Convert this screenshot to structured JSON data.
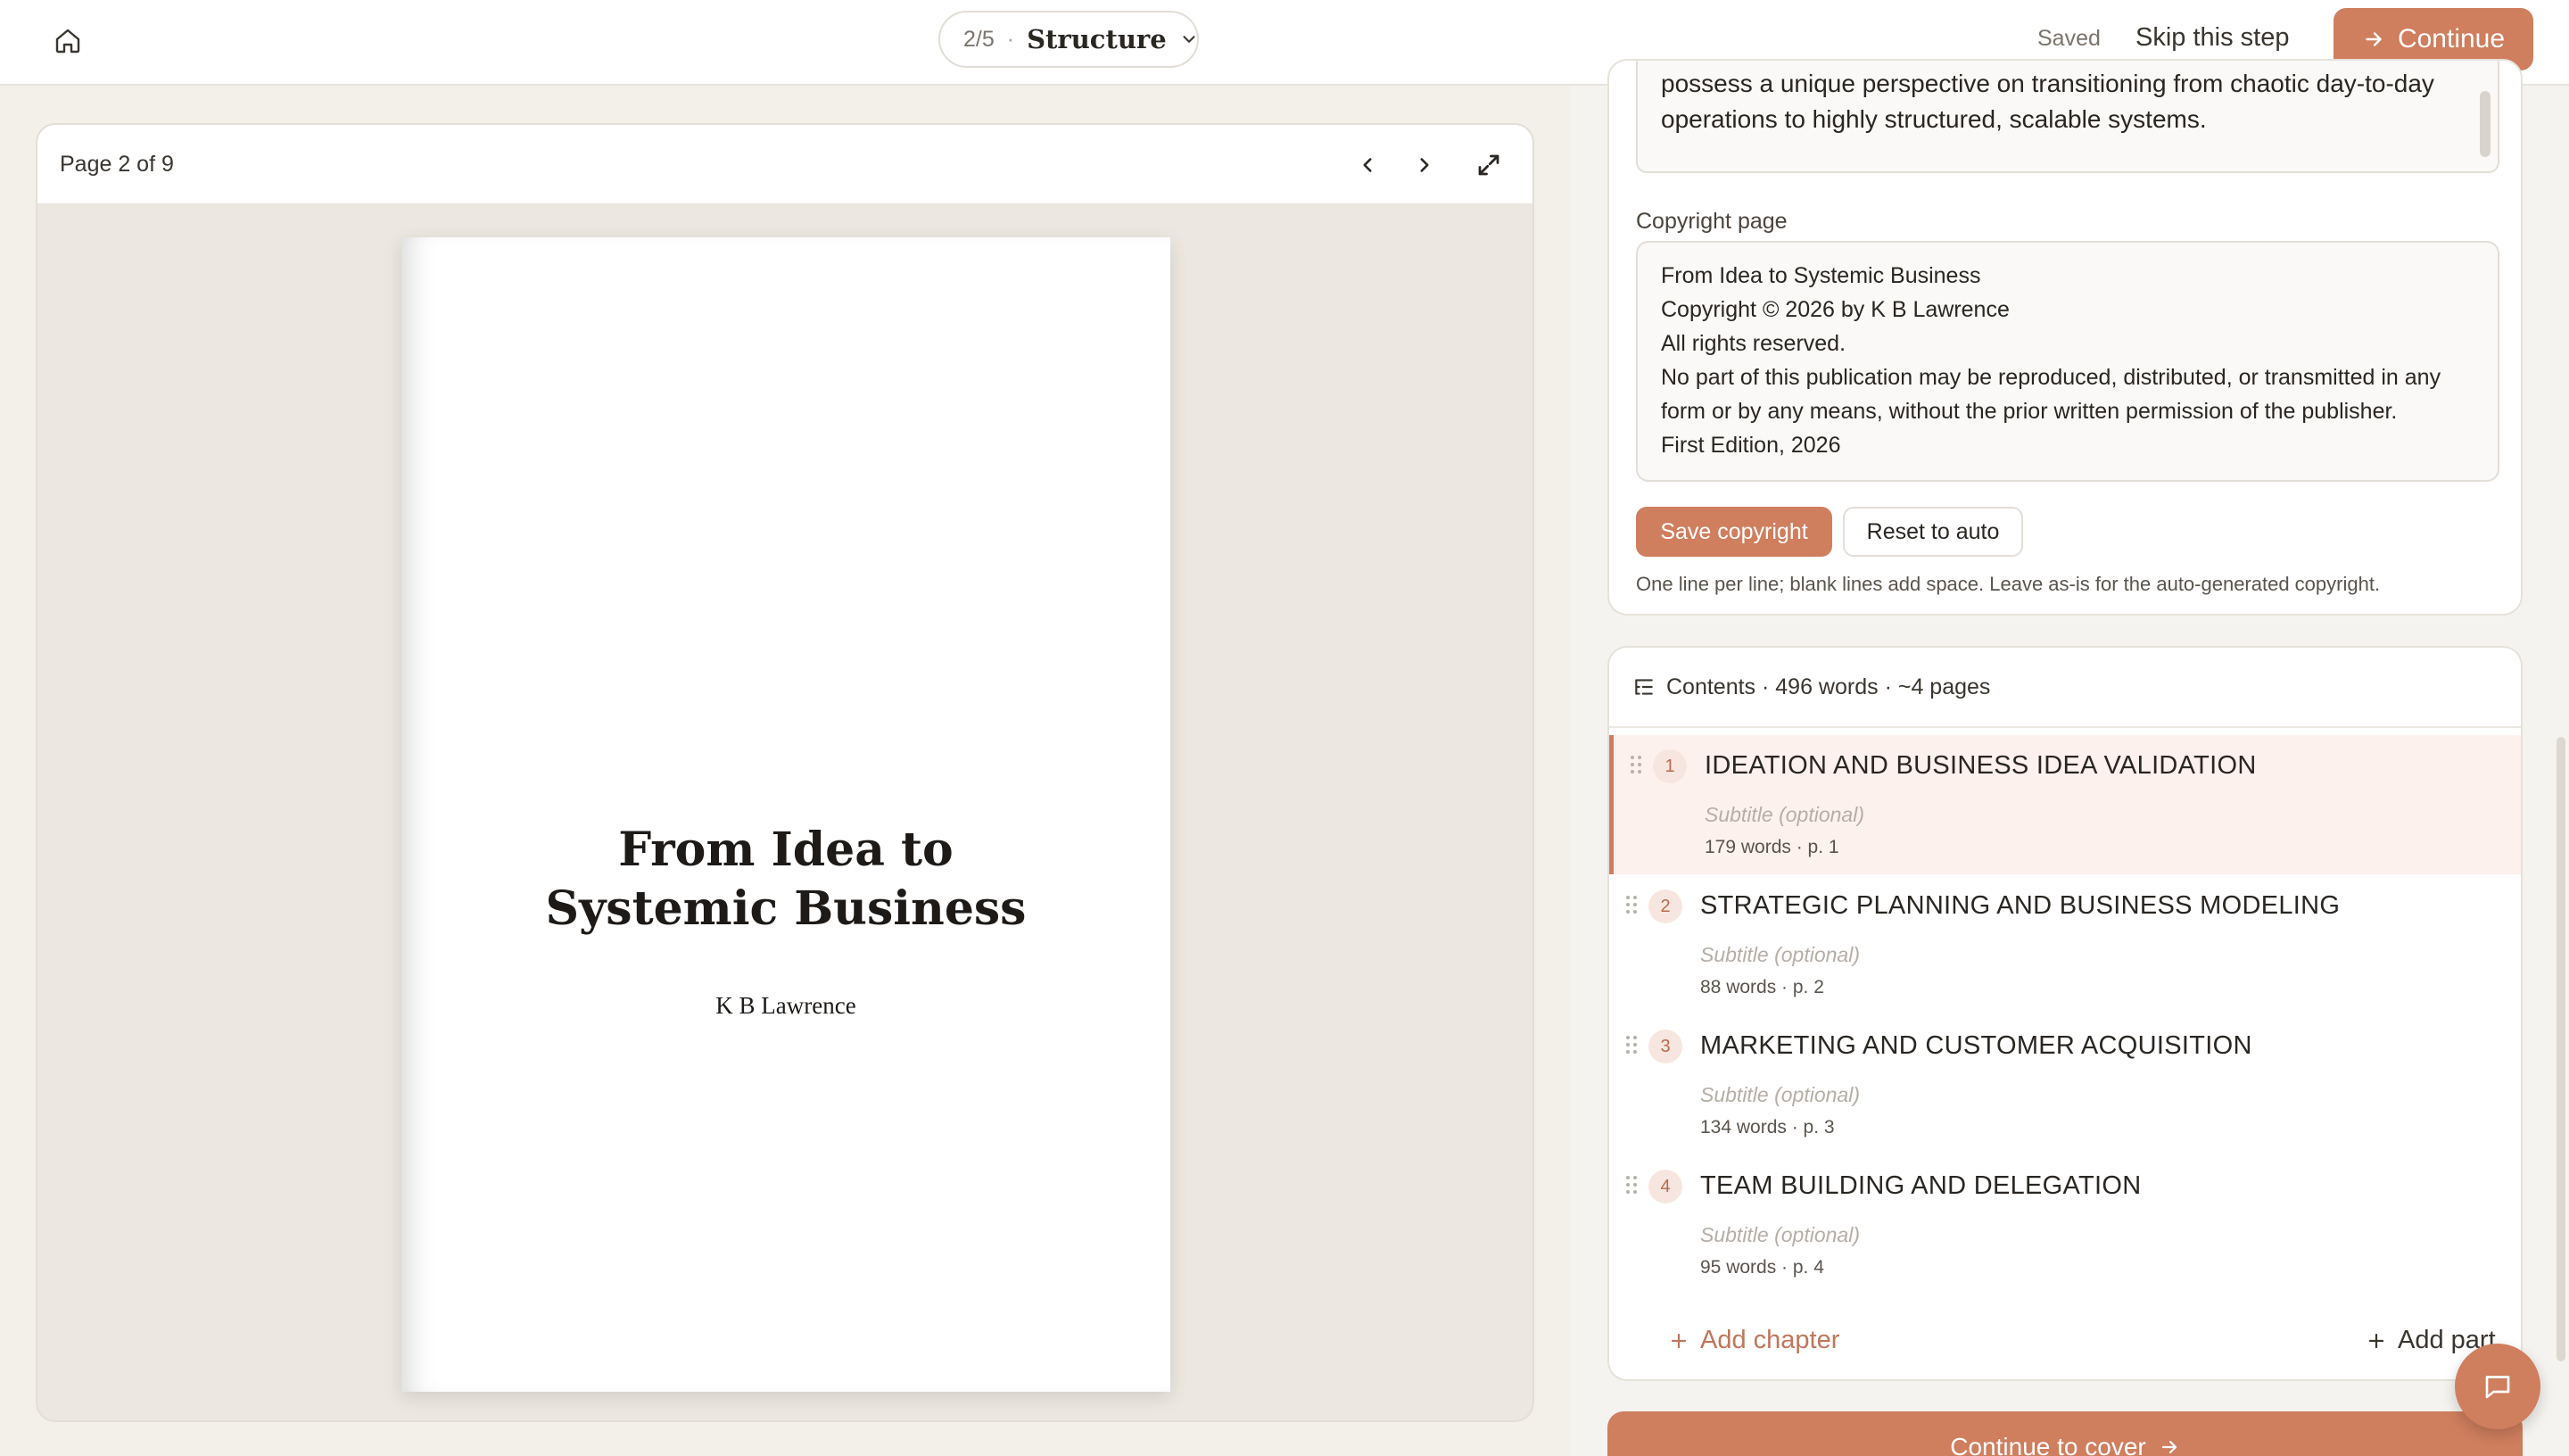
{
  "topbar": {
    "step_count": "2/5",
    "step_separator": "·",
    "step_name": "Structure",
    "saved_label": "Saved",
    "skip_label": "Skip this step",
    "continue_label": "Continue"
  },
  "preview": {
    "page_indicator": "Page 2 of 9",
    "book_title": "From Idea to Systemic Business",
    "book_author": "K B Lawrence"
  },
  "copyright": {
    "blurb_text": "possess a unique perspective on transitioning from chaotic day-to-day operations to highly structured, scalable systems.",
    "label": "Copyright page",
    "lines": [
      "From Idea to Systemic Business",
      "Copyright © 2026 by K B Lawrence",
      "All rights reserved.",
      "No part of this publication may be reproduced, distributed, or transmitted in any form or by any means, without the prior written permission of the publisher.",
      "First Edition, 2026"
    ],
    "save_label": "Save copyright",
    "reset_label": "Reset to auto",
    "hint": "One line per line; blank lines add space. Leave as-is for the auto-generated copyright."
  },
  "contents": {
    "header": "Contents · 496 words · ~4 pages",
    "chapters": [
      {
        "num": "1",
        "title": "IDEATION AND BUSINESS IDEA VALIDATION",
        "subtitle_placeholder": "Subtitle (optional)",
        "meta": "179 words · p. 1"
      },
      {
        "num": "2",
        "title": "STRATEGIC PLANNING AND BUSINESS MODELING",
        "subtitle_placeholder": "Subtitle (optional)",
        "meta": "88 words · p. 2"
      },
      {
        "num": "3",
        "title": "MARKETING AND CUSTOMER ACQUISITION",
        "subtitle_placeholder": "Subtitle (optional)",
        "meta": "134 words · p. 3"
      },
      {
        "num": "4",
        "title": "TEAM BUILDING AND DELEGATION",
        "subtitle_placeholder": "Subtitle (optional)",
        "meta": "95 words · p. 4"
      }
    ],
    "add_chapter_label": "Add chapter",
    "add_part_label": "Add part"
  },
  "footer": {
    "continue_cover_label": "Continue to cover"
  },
  "colors": {
    "accent": "#cf7e5e",
    "background": "#f3f0ea"
  }
}
